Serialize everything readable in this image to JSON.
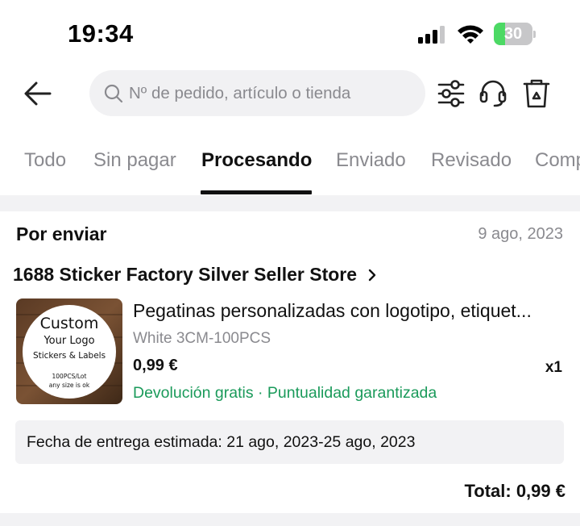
{
  "status_bar": {
    "time": "19:34",
    "battery_percent": "30",
    "battery_level": 0.3,
    "battery_color": "#4cd964"
  },
  "header": {
    "back_icon": "arrow-left-icon",
    "search_placeholder": "Nº de pedido, artículo o tienda",
    "icons": [
      "filter-sliders-icon",
      "headset-support-icon",
      "trash-recycle-icon"
    ]
  },
  "tabs": [
    {
      "label": "Todo",
      "active": false
    },
    {
      "label": "Sin pagar",
      "active": false
    },
    {
      "label": "Procesando",
      "active": true
    },
    {
      "label": "Enviado",
      "active": false
    },
    {
      "label": "Revisado",
      "active": false
    },
    {
      "label": "Comp",
      "active": false
    }
  ],
  "order": {
    "status": "Por enviar",
    "date": "9 ago, 2023",
    "store_name": "1688 Sticker Factory Silver Seller Store",
    "product": {
      "title": "Pegatinas personalizadas con logotipo, etiquet...",
      "variant": "White 3CM-100PCS",
      "price": "0,99 €",
      "quantity": "x1",
      "perks": "Devolución gratis · Puntualidad garantizada",
      "image_text": {
        "line1": "Custom",
        "line2": "Your Logo",
        "line3": "Stickers & Labels",
        "line4": "100PCS/Lot",
        "line5": "any size is ok"
      }
    },
    "delivery": "Fecha de entrega estimada: 21 ago, 2023-25 ago, 2023",
    "total": "Total: 0,99 €"
  },
  "colors": {
    "accent_green": "#1a9a5a",
    "muted_text": "#8a8a8f",
    "background_gray": "#f2f2f4"
  }
}
